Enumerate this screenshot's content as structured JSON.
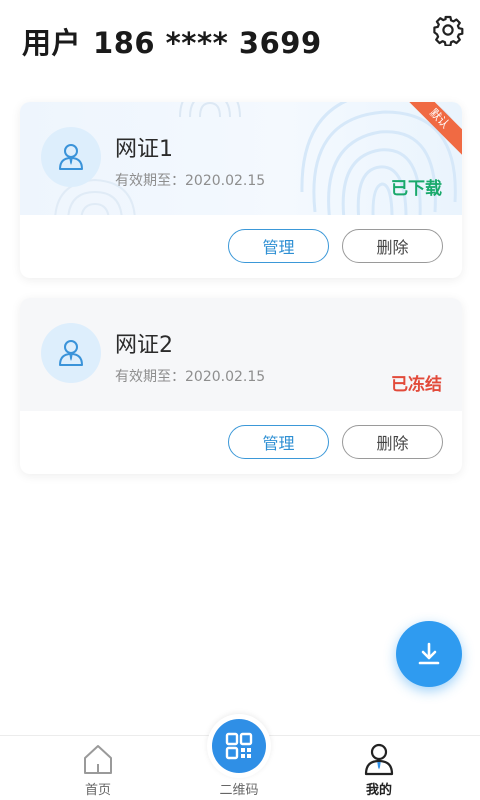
{
  "header": {
    "title_prefix": "用户",
    "phone": "186 **** 3699",
    "settings_icon": "gear-icon"
  },
  "colors": {
    "accent_blue": "#2f9bf0",
    "status_downloaded": "#19a96b",
    "status_frozen": "#e24a3a",
    "ribbon": "#f06a43"
  },
  "cards": [
    {
      "name": "网证1",
      "validity": "有效期至：2020.02.15",
      "status": "已下载",
      "status_color": "#19a96b",
      "badge": "默认",
      "manage_label": "管理",
      "delete_label": "删除",
      "avatar_icon": "user-icon"
    },
    {
      "name": "网证2",
      "validity": "有效期至：2020.02.15",
      "status": "已冻结",
      "status_color": "#e24a3a",
      "manage_label": "管理",
      "delete_label": "删除",
      "avatar_icon": "user-icon"
    }
  ],
  "fab": {
    "icon": "download-icon"
  },
  "tabbar": {
    "items": [
      {
        "label": "首页",
        "icon": "home-icon"
      },
      {
        "label": "二维码",
        "icon": "qr-code-icon"
      },
      {
        "label": "我的",
        "icon": "user-icon",
        "active": true
      }
    ]
  }
}
